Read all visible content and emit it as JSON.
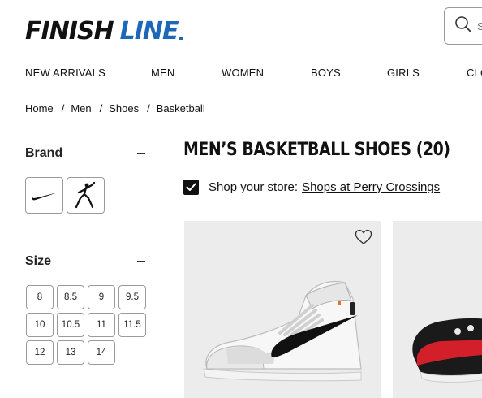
{
  "header": {
    "logo_primary": "FINISH",
    "logo_secondary": "LINE",
    "search_placeholder": "S",
    "search_icon": "search-icon"
  },
  "nav": {
    "items": [
      "NEW ARRIVALS",
      "MEN",
      "WOMEN",
      "BOYS",
      "GIRLS",
      "CLO"
    ]
  },
  "breadcrumb": [
    "Home",
    "Men",
    "Shoes",
    "Basketball"
  ],
  "breadcrumb_separator": "/",
  "filters": {
    "brand": {
      "title": "Brand",
      "tiles": [
        "nike-swoosh-logo",
        "jordan-jumpman-logo"
      ]
    },
    "size": {
      "title": "Size",
      "options": [
        "8",
        "8.5",
        "9",
        "9.5",
        "10",
        "10.5",
        "11",
        "11.5",
        "12",
        "13",
        "14"
      ]
    }
  },
  "main": {
    "title": "MEN’S BASKETBALL SHOES (20)",
    "store_label": "Shop your store:",
    "store_link": "Shops at Perry Crossings",
    "store_checked": true
  },
  "colors": {
    "brand_blue": "#1d67b8",
    "text": "#111111",
    "card_bg": "#ececec"
  }
}
